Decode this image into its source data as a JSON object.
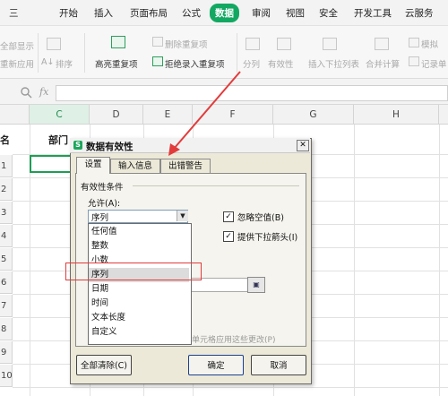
{
  "menubar": {
    "items": [
      "三",
      "开始",
      "插入",
      "页面布局",
      "公式",
      "数据",
      "审阅",
      "视图",
      "安全",
      "开发工具",
      "云服务"
    ],
    "active_index": 5
  },
  "toolbar": {
    "show_all": "全部显示",
    "reapply": "重新应用",
    "sort_icon_label": "A↓",
    "sort": "排序",
    "highlight_dup": "高亮重复项",
    "delete_dup": "删除重复项",
    "reject_dup": "拒绝录入重复项",
    "split": "分列",
    "validity": "有效性",
    "insert_dropdown": "插入下拉列表",
    "merge_calc": "合并计算",
    "simulate": "模拟",
    "record": "记录单"
  },
  "formula_bar": {
    "fx": "fx",
    "zoom_icon": "search-icon"
  },
  "grid": {
    "columns": [
      "C",
      "D",
      "E",
      "F",
      "G",
      "H"
    ],
    "rows": [
      "1",
      "2",
      "3",
      "4",
      "5",
      "6",
      "7",
      "8",
      "9",
      "10"
    ],
    "header_a": "名",
    "header_c": "部门"
  },
  "dialog": {
    "logo": "S",
    "title": "数据有效性",
    "close": "✕",
    "tabs": [
      "设置",
      "输入信息",
      "出错警告"
    ],
    "criteria": "有效性条件",
    "allow_label": "允许(A):",
    "allow_value": "序列",
    "dropdown_arrow": "▼",
    "dropdown_options": [
      "任何值",
      "整数",
      "小数",
      "序列",
      "日期",
      "时间",
      "文本长度",
      "自定义"
    ],
    "selected_option": "序列",
    "ignore_blank": {
      "label": "忽略空值(B)",
      "checked": true,
      "mark": "✓"
    },
    "provide_dropdown": {
      "label": "提供下拉箭头(I)",
      "checked": true,
      "mark": "✓"
    },
    "source_picker_icon": "▣",
    "apply_all": "所有单元格应用这些更改(P)",
    "buttons": {
      "clear_all": "全部清除(C)",
      "ok": "确定",
      "cancel": "取消"
    }
  },
  "colors": {
    "accent_green": "#13a862",
    "highlight_red": "#e23b3b",
    "selection_green": "#1f9d55"
  }
}
